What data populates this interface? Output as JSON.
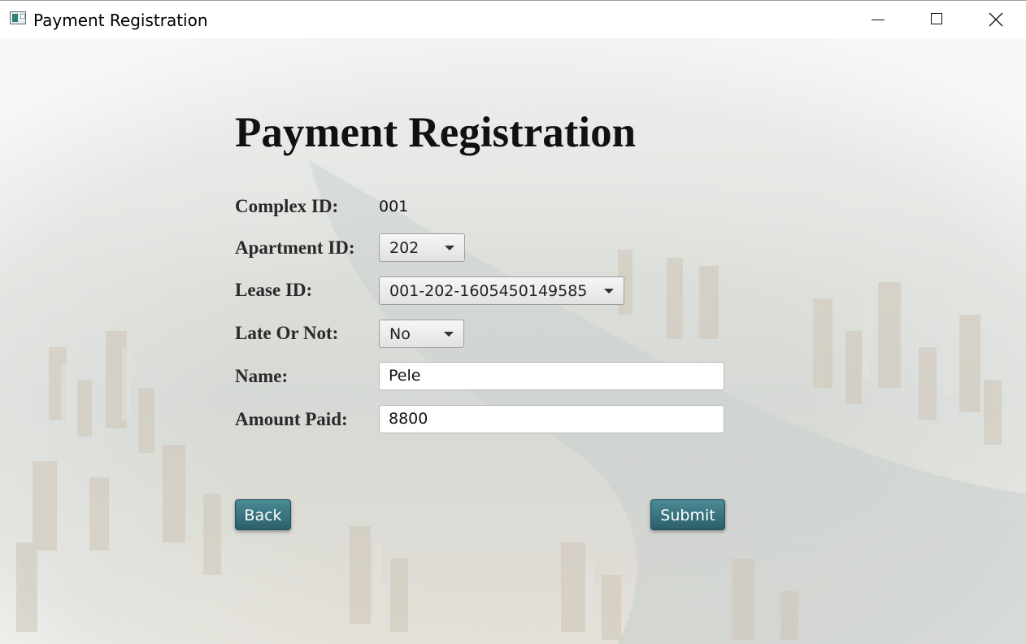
{
  "window": {
    "title": "Payment Registration",
    "controls": {
      "minimize": "minimize-icon",
      "maximize": "maximize-icon",
      "close": "close-icon"
    }
  },
  "form": {
    "heading": "Payment Registration",
    "complex_id": {
      "label": "Complex ID:",
      "value": "001"
    },
    "apartment_id": {
      "label": "Apartment ID:",
      "selected": "202"
    },
    "lease_id": {
      "label": "Lease ID:",
      "selected": "001-202-1605450149585"
    },
    "late_or_not": {
      "label": "Late Or Not:",
      "selected": "No"
    },
    "name": {
      "label": "Name:",
      "value": "Pele"
    },
    "amount_paid": {
      "label": "Amount Paid:",
      "value": "8800"
    }
  },
  "actions": {
    "back_label": "Back",
    "submit_label": "Submit"
  },
  "colors": {
    "button_accent": "#3a7380",
    "heading_text": "#111111"
  }
}
